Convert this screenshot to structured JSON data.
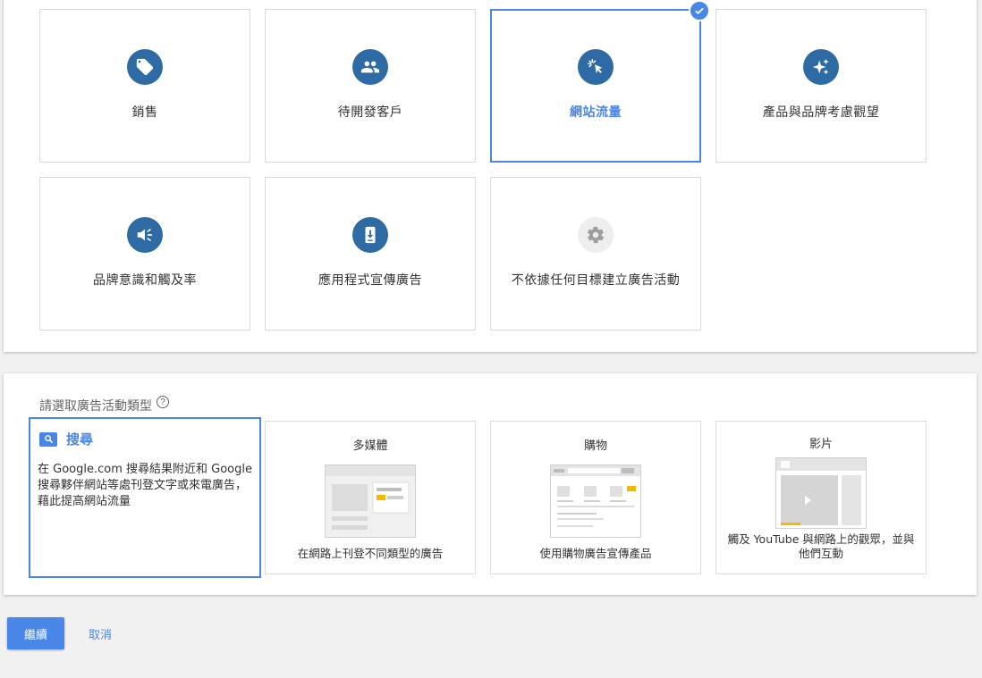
{
  "goals": {
    "sales": "銷售",
    "leads": "待開發客戶",
    "website_traffic": "網站流量",
    "product_brand_consideration": "產品與品牌考慮觀望",
    "brand_awareness_reach": "品牌意識和觸及率",
    "app_promotion": "應用程式宣傳廣告",
    "no_goal": "不依據任何目標建立廣告活動",
    "selected": "website_traffic"
  },
  "campaign_type": {
    "section_title": "請選取廣告活動類型",
    "help_glyph": "?",
    "search": {
      "title": "搜尋",
      "description": "在 Google.com 搜尋結果附近和 Google 搜尋夥伴網站等處刊登文字或來電廣告，藉此提高網站流量"
    },
    "display": {
      "title": "多媒體",
      "description": "在網路上刊登不同類型的廣告"
    },
    "shopping": {
      "title": "購物",
      "description": "使用購物廣告宣傳產品"
    },
    "video": {
      "title": "影片",
      "description": "觸及 YouTube 與網路上的觀眾，並與他們互動"
    },
    "selected": "search"
  },
  "actions": {
    "continue_label": "繼續",
    "cancel_label": "取消"
  },
  "colors": {
    "accent": "#4a86e8",
    "icon_bg": "#2e6aa4",
    "disabled_icon_bg": "#eeeeee"
  },
  "icons": {
    "sales": "tag-icon",
    "leads": "people-icon",
    "website_traffic": "cursor-click-icon",
    "product_brand_consideration": "sparkle-icon",
    "brand_awareness_reach": "megaphone-icon",
    "app_promotion": "mobile-download-icon",
    "no_goal": "gear-icon",
    "selected_badge": "check-icon",
    "search": "search-icon"
  }
}
